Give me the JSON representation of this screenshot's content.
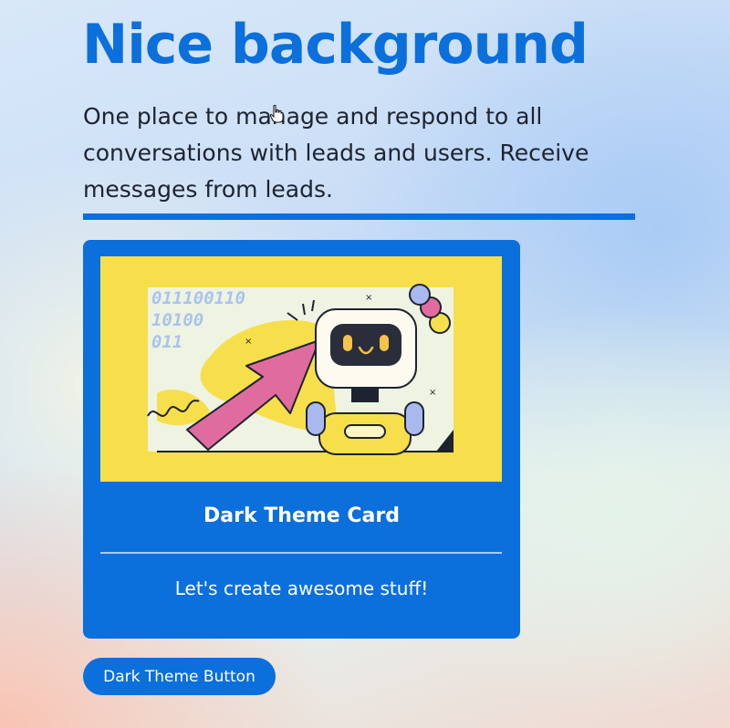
{
  "header": {
    "title": "Nice background",
    "description": "One place to manage and respond to all conversations with leads and users. Receive messages from leads."
  },
  "card": {
    "image_text_lines": [
      "011100110",
      "10100",
      "011"
    ],
    "title": "Dark Theme Card",
    "text": "Let's create awesome stuff!"
  },
  "button": {
    "label": "Dark Theme Button"
  },
  "colors": {
    "primary": "#0b6fdc",
    "card_image_bg": "#f6df4a",
    "text_dark": "#1d2330",
    "text_light": "#ffffff"
  },
  "icons": {
    "cursor": "hand-pointer-icon",
    "illustration": "robot-with-arrow-illustration"
  }
}
